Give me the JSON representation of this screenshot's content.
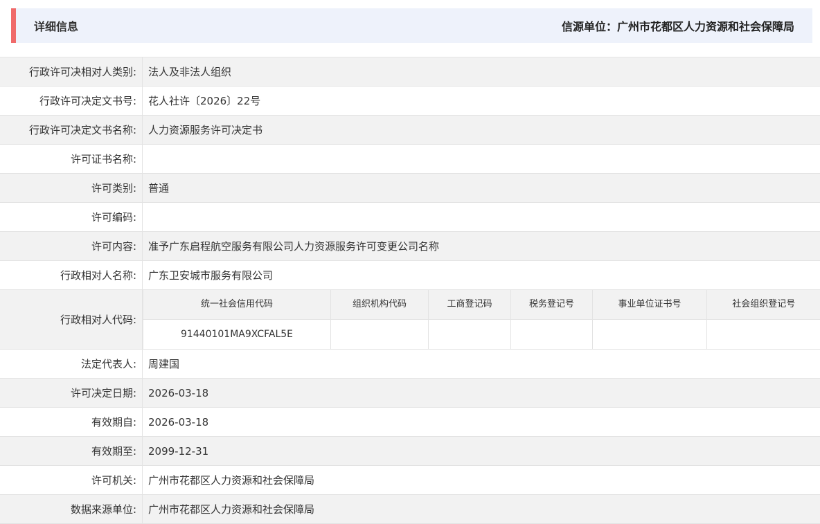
{
  "header": {
    "title": "详细信息",
    "source": "信源单位：广州市花都区人力资源和社会保障局"
  },
  "rows_top": [
    {
      "label": "行政许可决相对人类别:",
      "value": "法人及非法人组织"
    },
    {
      "label": "行政许可决定文书号:",
      "value": "花人社许〔2026〕22号"
    },
    {
      "label": "行政许可决定文书名称:",
      "value": "人力资源服务许可决定书"
    },
    {
      "label": "许可证书名称:",
      "value": ""
    },
    {
      "label": "许可类别:",
      "value": "普通"
    },
    {
      "label": "许可编码:",
      "value": ""
    },
    {
      "label": "许可内容:",
      "value": "准予广东启程航空服务有限公司人力资源服务许可变更公司名称"
    },
    {
      "label": "行政相对人名称:",
      "value": "广东卫安城市服务有限公司"
    }
  ],
  "code": {
    "label": "行政相对人代码:",
    "headers": [
      "统一社会信用代码",
      "组织机构代码",
      "工商登记码",
      "税务登记号",
      "事业单位证书号",
      "社会组织登记号"
    ],
    "values": [
      "91440101MA9XCFAL5E",
      "",
      "",
      "",
      "",
      ""
    ]
  },
  "rows_bottom": [
    {
      "label": "法定代表人:",
      "value": "周建国"
    },
    {
      "label": "许可决定日期:",
      "value": "2026-03-18"
    },
    {
      "label": "有效期自:",
      "value": "2026-03-18"
    },
    {
      "label": "有效期至:",
      "value": "2099-12-31"
    },
    {
      "label": "许可机关:",
      "value": "广州市花都区人力资源和社会保障局"
    },
    {
      "label": "数据来源单位:",
      "value": "广州市花都区人力资源和社会保障局"
    }
  ]
}
